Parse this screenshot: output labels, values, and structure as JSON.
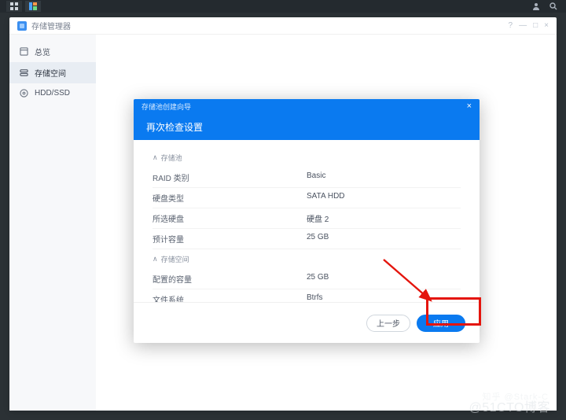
{
  "topbar": {
    "icons": [
      "grid-icon",
      "tile-icon"
    ],
    "right": [
      "user-icon",
      "search-icon"
    ]
  },
  "window": {
    "title": "存储管理器",
    "controls": {
      "help": "?",
      "min": "—",
      "max": "□",
      "close": "×"
    }
  },
  "sidebar": {
    "items": [
      {
        "icon": "dashboard-icon",
        "label": "总览"
      },
      {
        "icon": "storage-icon",
        "label": "存储空间"
      },
      {
        "icon": "disk-icon",
        "label": "HDD/SSD"
      }
    ],
    "selected_index": 1
  },
  "dialog": {
    "strip_label": "存储池创建向导",
    "header": "再次检查设置",
    "close_glyph": "×",
    "caret_glyph": "∧",
    "group1": {
      "title": "存储池",
      "rows": [
        {
          "label": "RAID 类别",
          "value": "Basic"
        },
        {
          "label": "硬盘类型",
          "value": "SATA HDD"
        },
        {
          "label": "所选硬盘",
          "value": "硬盘 2"
        },
        {
          "label": "预计容量",
          "value": "25 GB"
        }
      ]
    },
    "group2": {
      "title": "存储空间",
      "rows": [
        {
          "label": "配置的容量",
          "value": "25 GB"
        },
        {
          "label": "文件系统",
          "value": "Btrfs"
        }
      ]
    },
    "footer": {
      "back": "上一步",
      "apply": "应用"
    }
  },
  "watermark": {
    "line1": "知乎 @Stark-C",
    "line2": "@51CTO博客"
  }
}
